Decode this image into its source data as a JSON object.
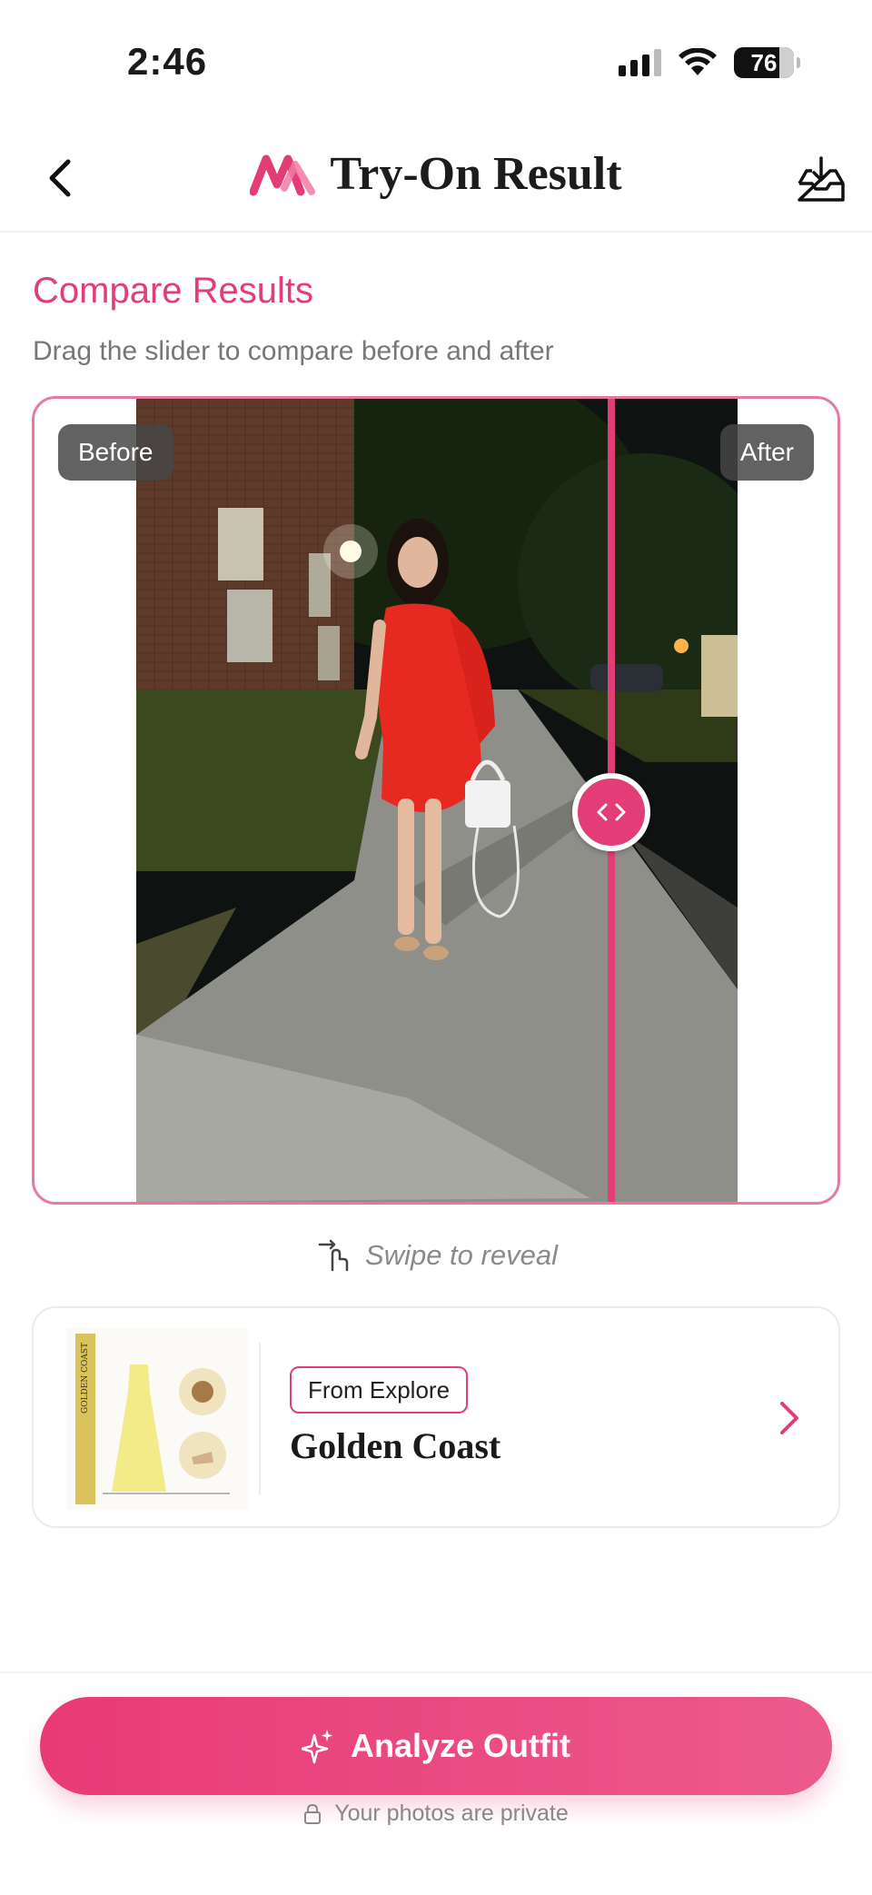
{
  "status_bar": {
    "time": "2:46",
    "battery": "76"
  },
  "header": {
    "title": "Try-On Result"
  },
  "compare": {
    "title": "Compare Results",
    "subtitle": "Drag the slider to compare before and after",
    "before_label": "Before",
    "after_label": "After",
    "slider_position": 0.79
  },
  "swipe_hint": "Swipe to reveal",
  "outfit": {
    "badge": "From Explore",
    "name": "Golden Coast",
    "thumb_text": "GOLDEN COAST"
  },
  "actions": {
    "analyze_label": "Analyze Outfit"
  },
  "privacy_text": "Your photos are private",
  "colors": {
    "accent": "#e23d77",
    "border": "#e57aa0",
    "muted": "#888888"
  }
}
